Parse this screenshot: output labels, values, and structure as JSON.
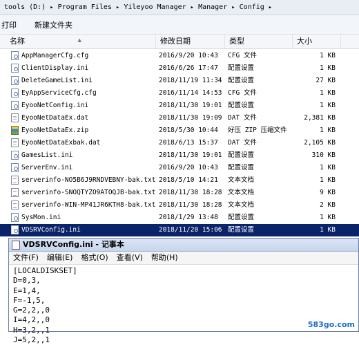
{
  "breadcrumb": [
    "tools (D:)",
    "Program Files",
    "Yileyoo Manager",
    "Manager",
    "Config"
  ],
  "toolbar": {
    "open_label": "打印",
    "new_folder_label": "新建文件夹"
  },
  "columns": {
    "name": "名称",
    "date": "修改日期",
    "type": "类型",
    "size": "大小"
  },
  "files": [
    {
      "name": "AppManagerCfg.cfg",
      "date": "2016/9/20 10:43",
      "type": "CFG 文件",
      "size": "1 KB",
      "icon": "cfg"
    },
    {
      "name": "ClientDisplay.ini",
      "date": "2016/6/26 17:47",
      "type": "配置设置",
      "size": "1 KB",
      "icon": "cfg"
    },
    {
      "name": "DeleteGameList.ini",
      "date": "2018/11/19 11:34",
      "type": "配置设置",
      "size": "27 KB",
      "icon": "cfg"
    },
    {
      "name": "EyAppServiceCfg.cfg",
      "date": "2016/11/14 14:53",
      "type": "CFG 文件",
      "size": "1 KB",
      "icon": "cfg"
    },
    {
      "name": "EyooNetConfig.ini",
      "date": "2018/11/30 19:01",
      "type": "配置设置",
      "size": "1 KB",
      "icon": "cfg"
    },
    {
      "name": "EyooNetDataEx.dat",
      "date": "2018/11/30 19:09",
      "type": "DAT 文件",
      "size": "2,381 KB",
      "icon": "dat"
    },
    {
      "name": "EyooNetDataEx.zip",
      "date": "2018/5/30 10:44",
      "type": "好压 ZIP 压缩文件",
      "size": "1 KB",
      "icon": "zip"
    },
    {
      "name": "EyooNetDataExbak.dat",
      "date": "2018/6/13 15:37",
      "type": "DAT 文件",
      "size": "2,105 KB",
      "icon": "dat"
    },
    {
      "name": "GamesList.ini",
      "date": "2018/11/30 19:01",
      "type": "配置设置",
      "size": "310 KB",
      "icon": "cfg"
    },
    {
      "name": "ServerEnv.ini",
      "date": "2016/9/20 10:43",
      "type": "配置设置",
      "size": "1 KB",
      "icon": "cfg"
    },
    {
      "name": "serverinfo-NO5B6J9RNDVEBNY-bak.txt",
      "date": "2018/5/10 14:21",
      "type": "文本文档",
      "size": "1 KB",
      "icon": "txt"
    },
    {
      "name": "serverinfo-SNOQTYZO9ATOQJB-bak.txt",
      "date": "2018/11/30 18:28",
      "type": "文本文档",
      "size": "9 KB",
      "icon": "txt"
    },
    {
      "name": "serverinfo-WIN-MP41JR6KTH8-bak.txt",
      "date": "2018/11/30 18:28",
      "type": "文本文档",
      "size": "2 KB",
      "icon": "txt"
    },
    {
      "name": "SysMon.ini",
      "date": "2018/1/29 13:48",
      "type": "配置设置",
      "size": "1 KB",
      "icon": "cfg"
    },
    {
      "name": "VDSRVConfig.ini",
      "date": "2018/11/20 15:06",
      "type": "配置设置",
      "size": "1 KB",
      "icon": "cfg",
      "selected": true
    }
  ],
  "notepad": {
    "title": "VDSRVConfig.ini - 记事本",
    "menu": [
      "文件(F)",
      "编辑(E)",
      "格式(O)",
      "查看(V)",
      "帮助(H)"
    ],
    "lines": [
      "[LOCALDISKSET]",
      "D=0,3,",
      "E=1,4,",
      "F=-1,5,",
      "G=2,2,,0",
      "I=4,2,,0",
      "H=3,2,,1",
      "J=5,2,,1"
    ]
  },
  "watermark": "583go.com"
}
